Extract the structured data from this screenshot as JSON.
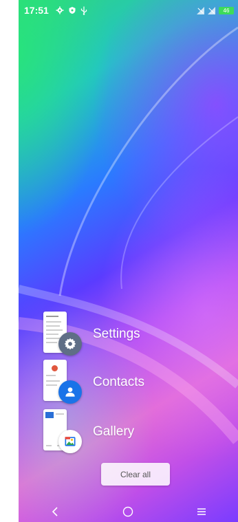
{
  "status_bar": {
    "time": "17:51",
    "left_icons": [
      "gear-icon",
      "shield-icon",
      "usb-icon"
    ],
    "right_icons": [
      "no-signal-icon",
      "no-signal-icon",
      "battery-charging-icon"
    ],
    "battery_level": "46"
  },
  "recents": {
    "apps": [
      {
        "label": "Settings",
        "icon": "settings-gear-icon",
        "color": "#5f6e86"
      },
      {
        "label": "Contacts",
        "icon": "person-icon",
        "color": "#1a73e8"
      },
      {
        "label": "Gallery",
        "icon": "gallery-icon",
        "color": "#ffffff"
      }
    ],
    "clear_all_label": "Clear all"
  },
  "navigation": {
    "back": "back-icon",
    "home": "home-icon",
    "recents": "menu-icon"
  },
  "colors": {
    "battery": "#3ddc5a",
    "contacts_blue": "#1a73e8",
    "settings_grey": "#5f6e86"
  }
}
